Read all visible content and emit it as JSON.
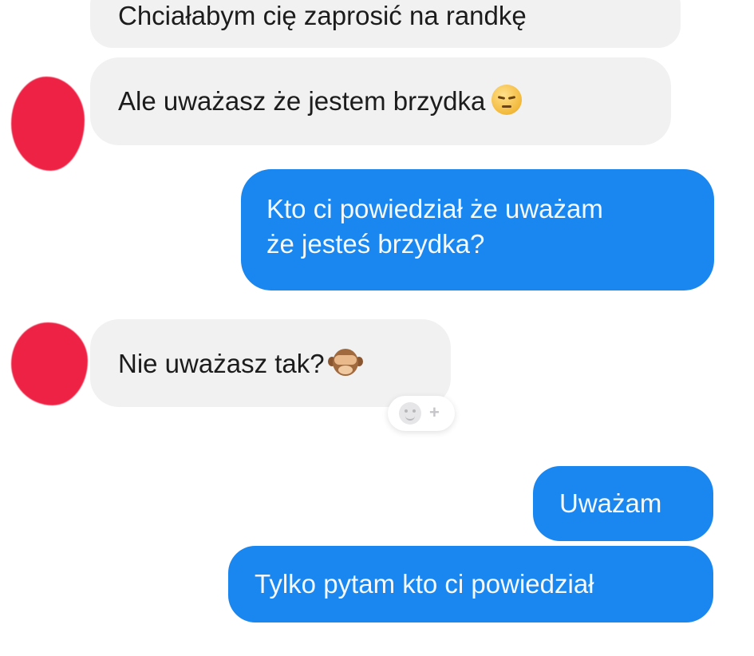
{
  "conversation": {
    "messages": [
      {
        "direction": "incoming",
        "text": "Chciałabym cię zaprosić na randkę"
      },
      {
        "direction": "incoming",
        "text": "Ale uważasz że jestem brzydka",
        "emoji": "pensive-face-emoji"
      },
      {
        "direction": "outgoing",
        "lines": [
          "Kto ci powiedział że uważam",
          "że jesteś brzydka?"
        ]
      },
      {
        "direction": "incoming",
        "text": "Nie uważasz tak?",
        "emoji": "see-no-evil-monkey-emoji"
      },
      {
        "direction": "outgoing",
        "text": "Uważam"
      },
      {
        "direction": "outgoing",
        "text": "Tylko pytam kto ci powiedział"
      }
    ],
    "reaction_button": {
      "icon": "smiley-face-icon",
      "plus": "+"
    }
  },
  "colors": {
    "incoming_bubble": "#f1f1f2",
    "outgoing_bubble": "#1a86f0",
    "avatar_censor": "#ee2244"
  }
}
